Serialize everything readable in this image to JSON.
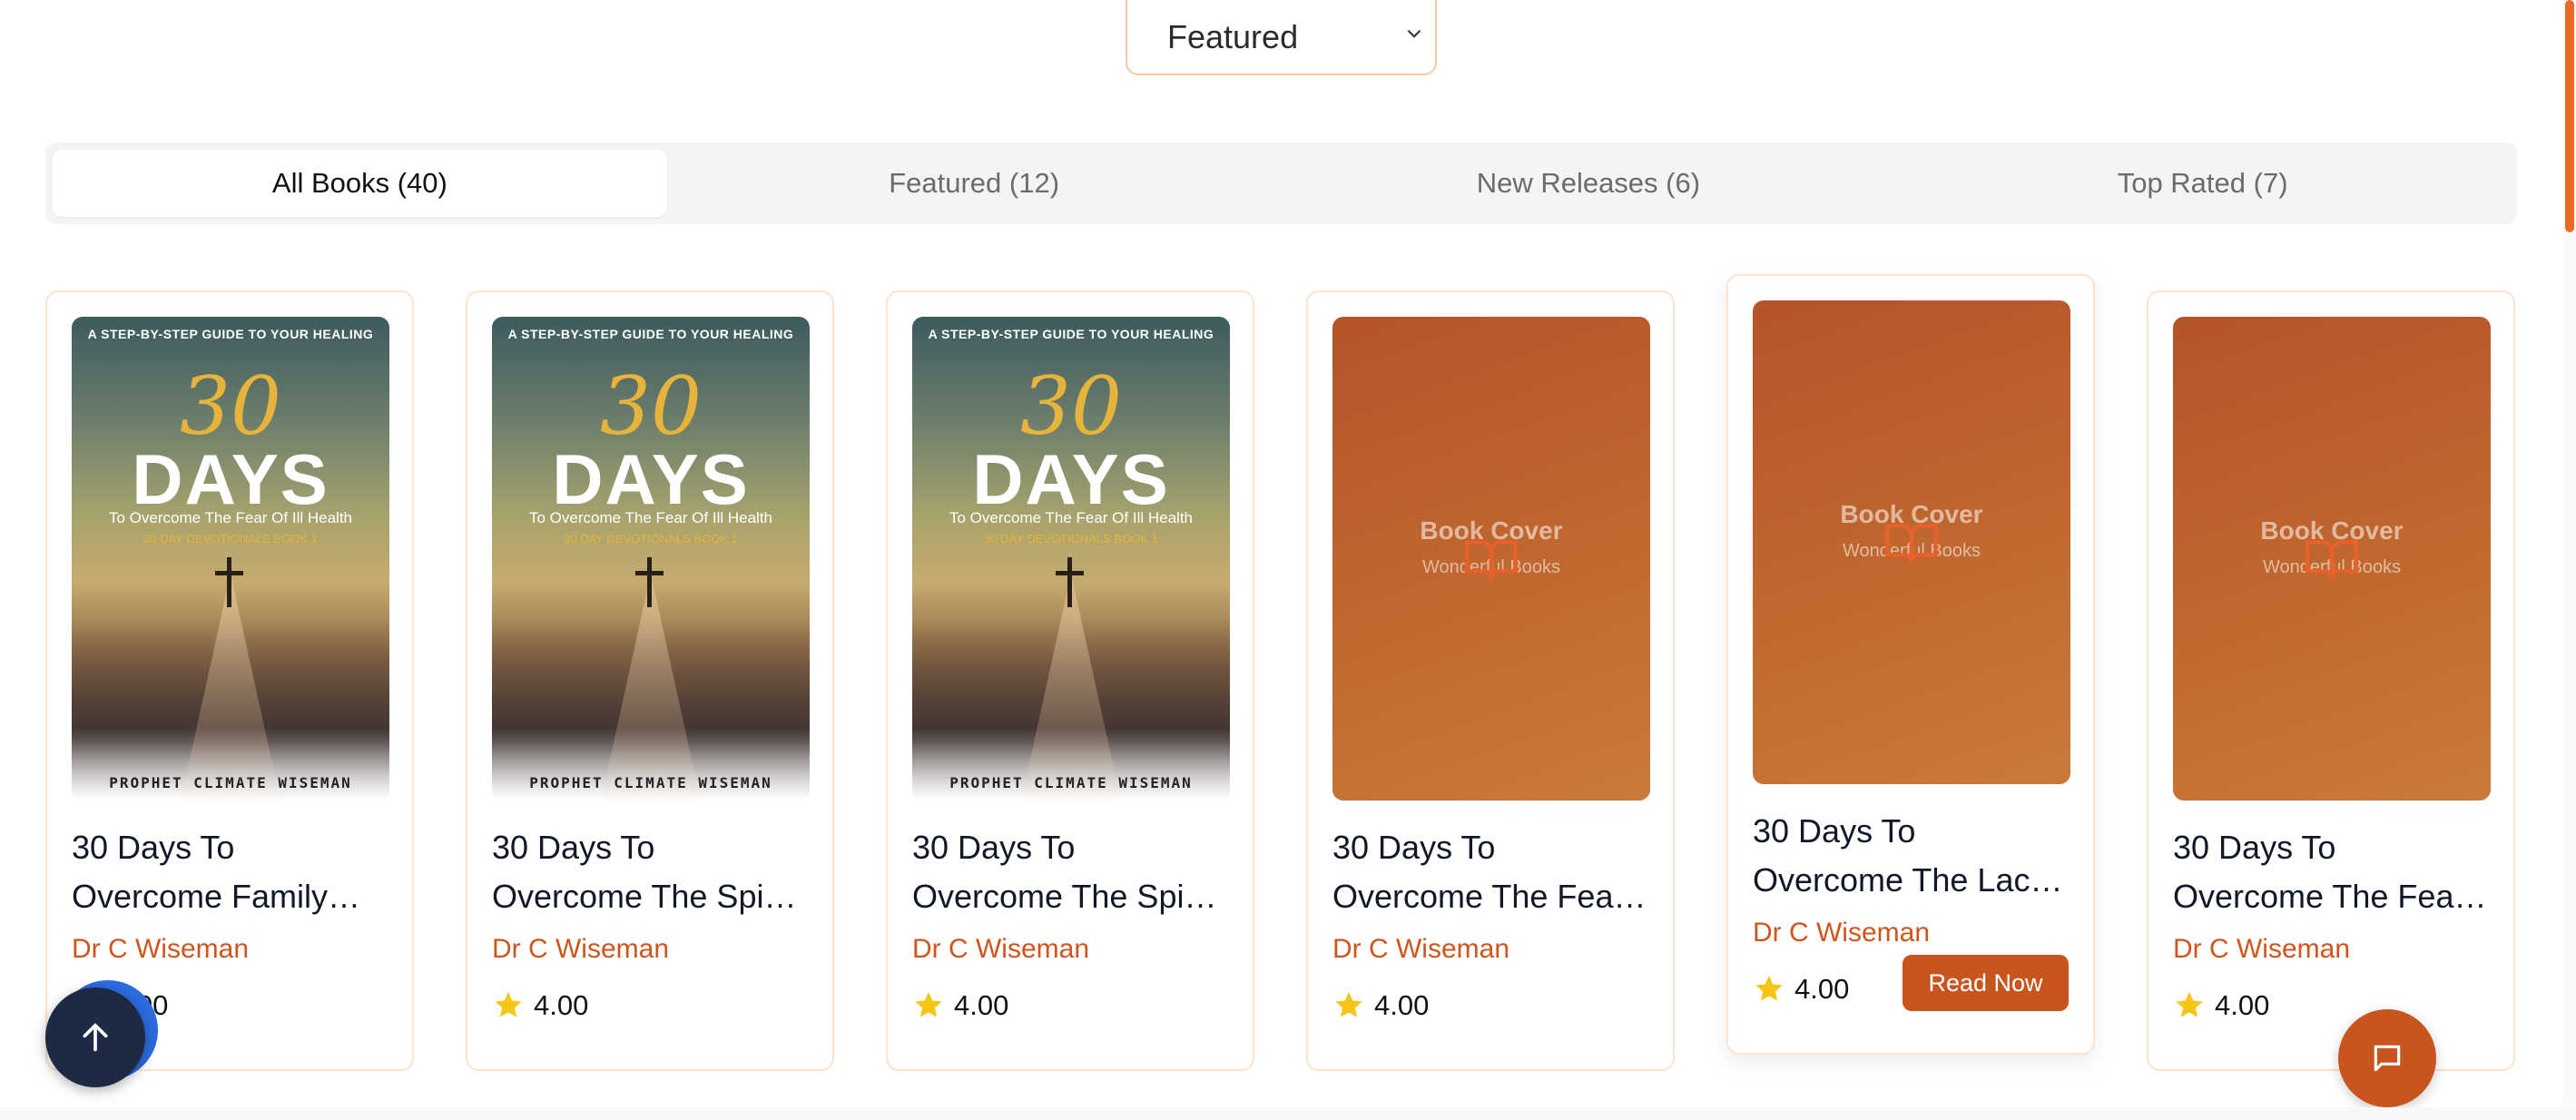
{
  "sort": {
    "selected": "Featured"
  },
  "tabs": [
    {
      "label": "All Books (40)",
      "active": true
    },
    {
      "label": "Featured (12)",
      "active": false
    },
    {
      "label": "New Releases (6)",
      "active": false
    },
    {
      "label": "Top Rated (7)",
      "active": false
    }
  ],
  "cover_text": {
    "tagline": "A STEP-BY-STEP GUIDE TO YOUR HEALING",
    "number": "30",
    "days": "DAYS",
    "subtitle": "To Overcome The Fear Of Ill Health",
    "series": "30 DAY DEVOTIONALS BOOK 1",
    "author": "PROPHET CLIMATE WISEMAN",
    "placeholder_title": "Book Cover",
    "placeholder_sub": "Wonderful Books"
  },
  "books": [
    {
      "title": "30 Days To Overcome Family…",
      "author": "Dr C Wiseman",
      "rating": "4.00"
    },
    {
      "title": "30 Days To Overcome The Spi…",
      "author": "Dr C Wiseman",
      "rating": "4.00"
    },
    {
      "title": "30 Days To Overcome The Spi…",
      "author": "Dr C Wiseman",
      "rating": "4.00"
    },
    {
      "title": "30 Days To Overcome The Fea…",
      "author": "Dr C Wiseman",
      "rating": "4.00"
    },
    {
      "title": "30 Days To Overcome The Lac…",
      "author": "Dr C Wiseman",
      "rating": "4.00",
      "button": "Read Now"
    },
    {
      "title": "30 Days To Overcome The Fea…",
      "author": "Dr C Wiseman",
      "rating": "4.00"
    }
  ],
  "colors": {
    "accent": "#c8541e",
    "author_text": "#d2541d",
    "star": "#f5c518",
    "scroll_top_bg": "#1e2a44"
  },
  "icons": {
    "sort": "chevron-down-icon",
    "rating": "star-icon",
    "scroll_top": "arrow-up-icon",
    "chat": "chat-bubble-icon",
    "placeholder": "book-open-icon"
  }
}
